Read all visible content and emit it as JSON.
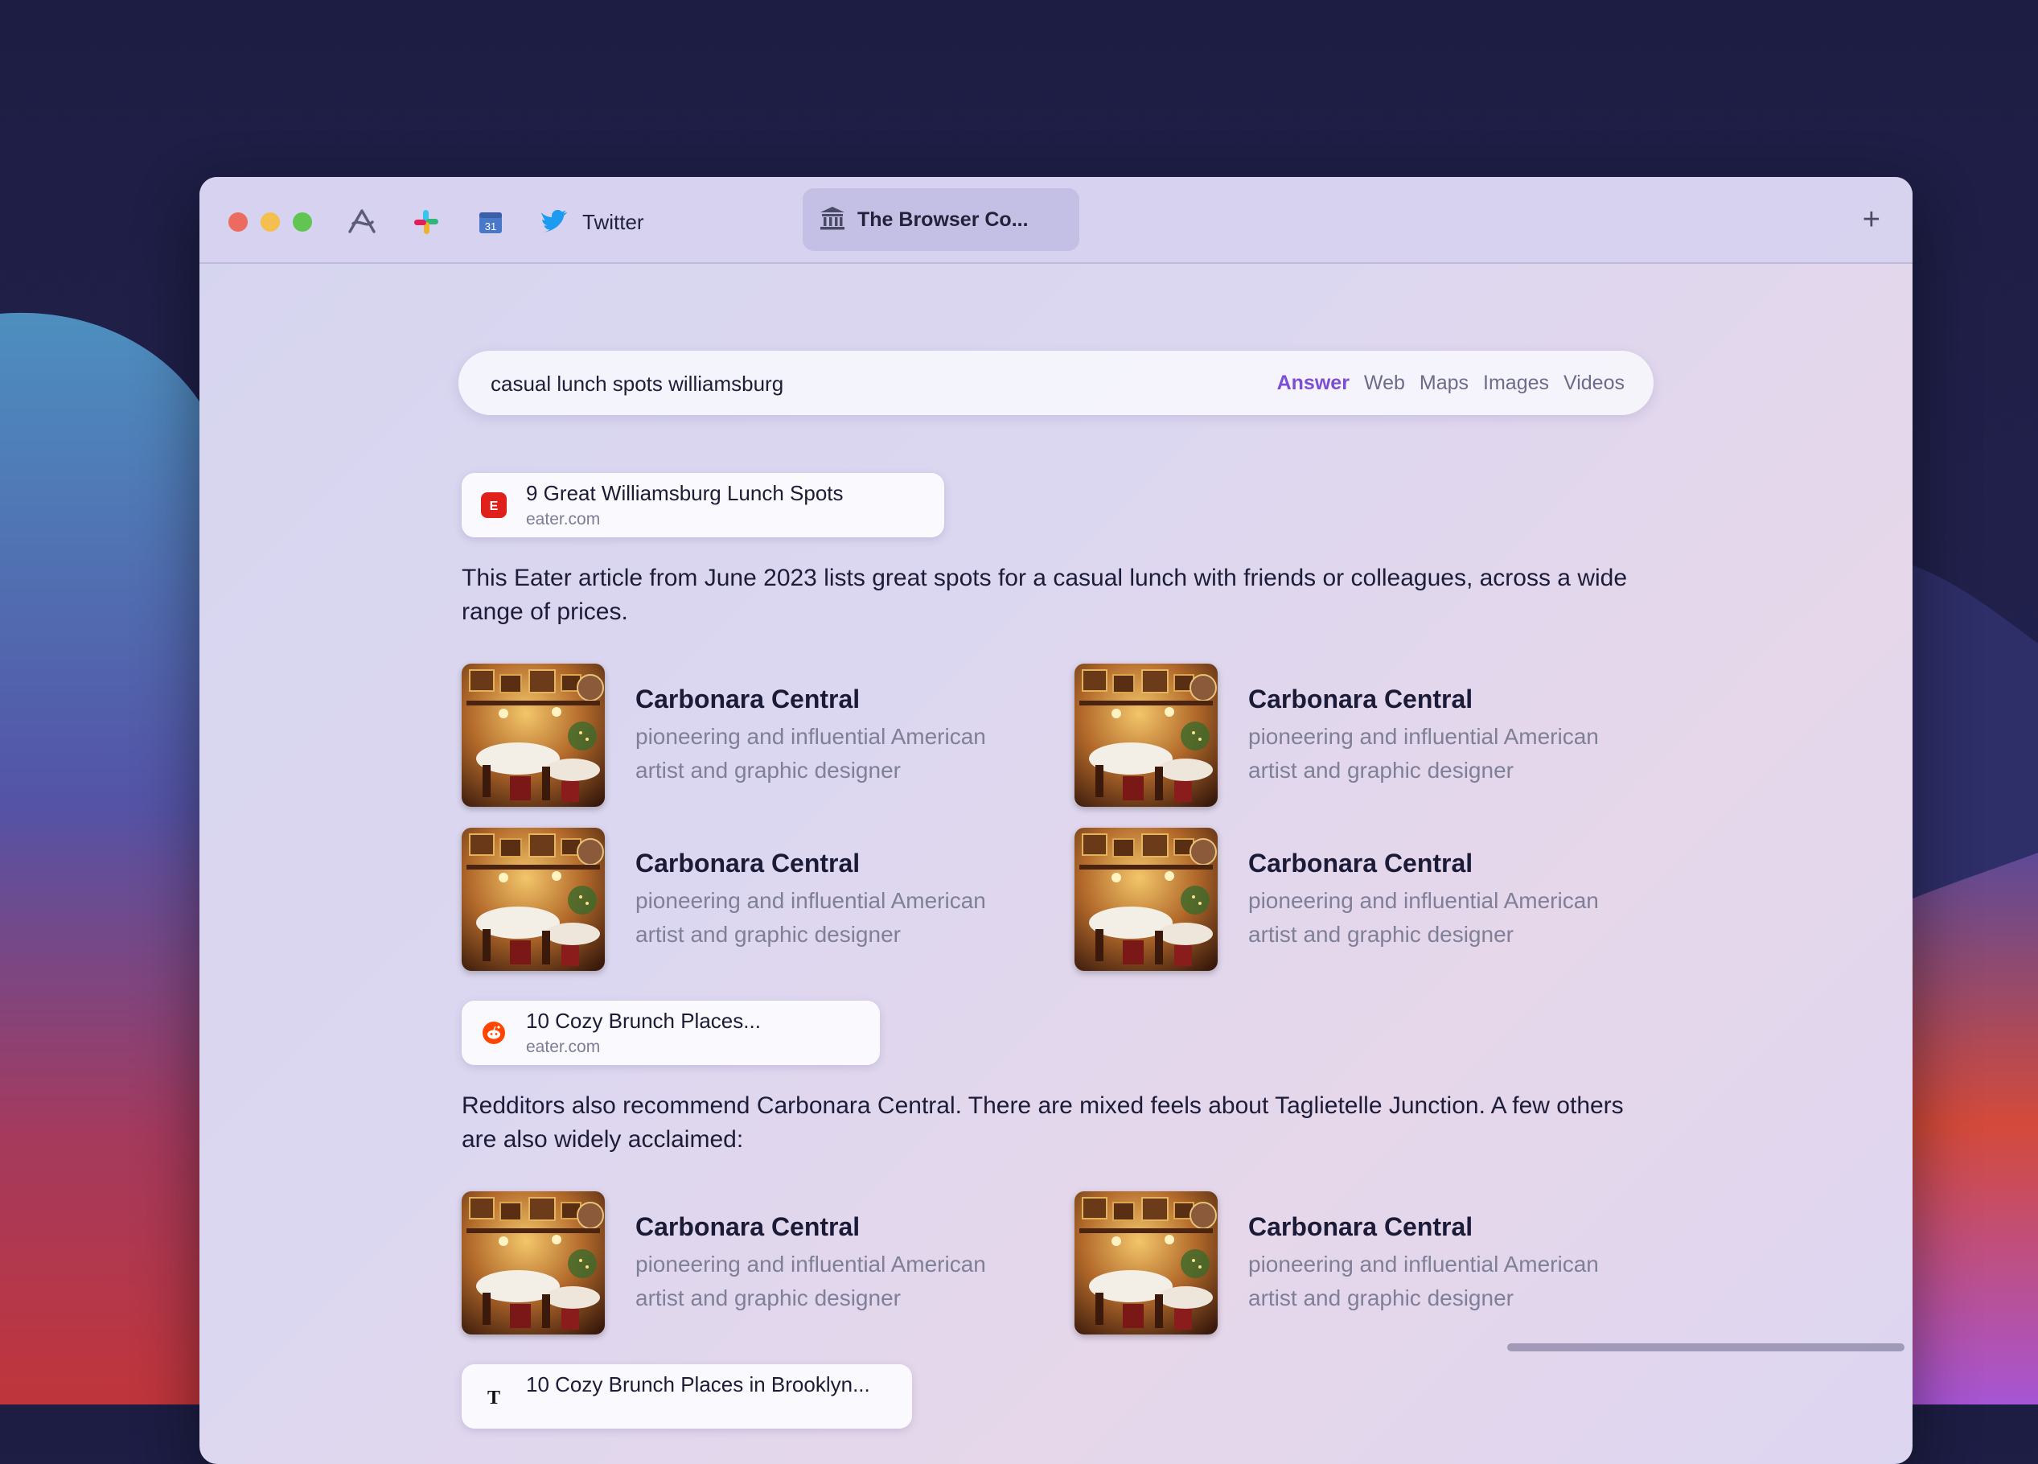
{
  "browser": {
    "pinned_twitter_label": "Twitter",
    "active_tab_title": "The Browser Co...",
    "new_tab_icon": "plus-icon"
  },
  "search": {
    "query": "casual lunch spots williamsburg",
    "tabs": [
      "Answer",
      "Web",
      "Maps",
      "Images",
      "Videos"
    ],
    "active_tab": "Answer"
  },
  "sections": [
    {
      "source": {
        "title": "9 Great Williamsburg Lunch Spots",
        "domain": "eater.com",
        "icon": "eater-icon",
        "icon_color": "#e0201b"
      },
      "summary": "This Eater article from June 2023 lists great spots for a casual lunch with friends or colleagues, across a wide range of prices.",
      "cards": [
        {
          "title": "Carbonara Central",
          "desc": "pioneering and influential American artist and graphic designer"
        },
        {
          "title": "Carbonara Central",
          "desc": "pioneering and influential American artist and graphic designer"
        },
        {
          "title": "Carbonara Central",
          "desc": "pioneering and influential American artist and graphic designer"
        },
        {
          "title": "Carbonara Central",
          "desc": "pioneering and influential American artist and graphic designer"
        }
      ]
    },
    {
      "source": {
        "title": "10 Cozy Brunch Places...",
        "domain": "eater.com",
        "icon": "reddit-icon",
        "icon_color": "#ff4500"
      },
      "summary": "Redditors also recommend Carbonara Central. There are mixed feels about Taglietelle Junction. A few others are also widely acclaimed:",
      "cards": [
        {
          "title": "Carbonara Central",
          "desc": "pioneering and influential American artist and graphic designer"
        },
        {
          "title": "Carbonara Central",
          "desc": "pioneering and influential American artist and graphic designer"
        }
      ]
    },
    {
      "source": {
        "title": "10 Cozy Brunch Places in Brooklyn...",
        "icon": "nytimes-icon"
      }
    }
  ],
  "colors": {
    "accent": "#7c4fd2",
    "text": "#1d1d3a",
    "muted": "#7f7f98"
  }
}
